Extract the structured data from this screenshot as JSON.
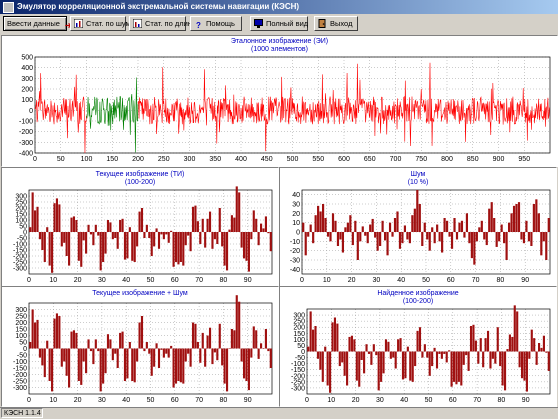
{
  "window": {
    "title": "Эмулятор корреляционной экстремальной системы навигации (КЭСН)"
  },
  "toolbar": {
    "enter_data": "Ввести данные",
    "stat_noise": "Стат. по шуму",
    "stat_length": "Стат. по длине",
    "help": "Помощь",
    "full_view": "Полный вид",
    "exit": "Выход"
  },
  "icons": [
    "arrow-right-icon",
    "chart-icon",
    "chart-icon",
    "help-icon",
    "monitor-icon",
    "exit-door-icon"
  ],
  "colors": {
    "reference": "#ff0000",
    "highlight": "#008000",
    "bars": "#a01010",
    "titles": "#0000c0"
  },
  "status": {
    "version": "КЭСН 1.1.4"
  },
  "charts": {
    "reference": {
      "title": "Эталонное изображение (ЭИ)",
      "subtitle": "(1000 элементов)"
    },
    "current": {
      "title": "Текущее изображение (ТИ)",
      "subtitle": "(100-200)"
    },
    "noise": {
      "title": "Шум",
      "subtitle": "(10 %)"
    },
    "current_noise": {
      "title": "Текущее изображение + Шум",
      "subtitle": ""
    },
    "found": {
      "title": "Найденное изображение",
      "subtitle": "(100-200)"
    }
  },
  "chart_data": [
    {
      "type": "line",
      "title": "Эталонное изображение (ЭИ)",
      "subtitle": "(1000 элементов)",
      "xlim": [
        0,
        1000
      ],
      "ylim": [
        -400,
        500
      ],
      "xticks": [
        0,
        50,
        100,
        150,
        200,
        250,
        300,
        350,
        400,
        450,
        500,
        550,
        600,
        650,
        700,
        750,
        800,
        850,
        900,
        950
      ],
      "yticks": [
        500,
        400,
        300,
        200,
        100,
        0,
        -100,
        -200,
        -300,
        -400
      ],
      "highlight_range": [
        100,
        200
      ],
      "n": 1000,
      "grid": true
    },
    {
      "type": "bar",
      "title": "Текущее изображение (ТИ)",
      "subtitle": "(100-200)",
      "xlim": [
        0,
        100
      ],
      "ylim": [
        -350,
        350
      ],
      "xticks": [
        0,
        10,
        20,
        30,
        40,
        50,
        60,
        70,
        80,
        90
      ],
      "yticks": [
        300,
        250,
        200,
        150,
        100,
        50,
        0,
        -50,
        -100,
        -150,
        -200,
        -250,
        -300
      ],
      "values": [
        40,
        330,
        180,
        210,
        -60,
        -150,
        -250,
        40,
        -280,
        -340,
        240,
        280,
        230,
        -120,
        -90,
        -200,
        -280,
        120,
        130,
        100,
        -240,
        -290,
        -70,
        -180,
        60,
        -20,
        -110,
        60,
        -30,
        -320,
        -250,
        -180,
        100,
        80,
        -60,
        -50,
        -140,
        100,
        110,
        -230,
        -220,
        40,
        -240,
        -250,
        -120,
        170,
        200,
        -50,
        60,
        -50,
        -200,
        -120,
        30,
        -140,
        -20,
        -60,
        -20,
        -90,
        10,
        -290,
        -250,
        -270,
        -250,
        -280,
        -110,
        -30,
        -160,
        210,
        220,
        90,
        -100,
        110,
        -130,
        110,
        170,
        -140,
        -60,
        -100,
        200,
        -120,
        -280,
        -320,
        20,
        140,
        120,
        380,
        330,
        -130,
        -220,
        -240,
        -330,
        -60,
        180,
        110,
        -110,
        70,
        30,
        130,
        -10,
        -160
      ]
    },
    {
      "type": "bar",
      "title": "Шум",
      "subtitle": "(10 %)",
      "xlim": [
        0,
        100
      ],
      "ylim": [
        -45,
        45
      ],
      "xticks": [
        0,
        10,
        20,
        30,
        40,
        50,
        60,
        70,
        80,
        90
      ],
      "yticks": [
        40,
        30,
        20,
        10,
        0,
        -10,
        -20,
        -30,
        -40
      ],
      "values": [
        10,
        -25,
        -5,
        8,
        -12,
        18,
        28,
        22,
        30,
        15,
        -5,
        -10,
        20,
        12,
        -15,
        -8,
        -22,
        5,
        10,
        18,
        -14,
        12,
        -30,
        -10,
        6,
        -4,
        -12,
        8,
        14,
        -6,
        -20,
        -15,
        12,
        -9,
        -25,
        10,
        -5,
        15,
        22,
        -18,
        -12,
        7,
        -8,
        -12,
        18,
        25,
        45,
        30,
        -15,
        10,
        -8,
        -20,
        5,
        -12,
        8,
        -10,
        -22,
        15,
        12,
        -5,
        -18,
        15,
        -8,
        10,
        12,
        -6,
        20,
        -12,
        -28,
        -35,
        -10,
        5,
        12,
        -8,
        -14,
        25,
        32,
        15,
        -16,
        -10,
        8,
        -12,
        -30,
        10,
        20,
        28,
        30,
        32,
        -8,
        -12,
        12,
        -10,
        -15,
        30,
        35,
        20,
        -25,
        -10,
        -30,
        15
      ]
    },
    {
      "type": "bar",
      "title": "Текущее изображение + Шум",
      "subtitle": "",
      "xlim": [
        0,
        100
      ],
      "ylim": [
        -350,
        350
      ],
      "xticks": [
        0,
        10,
        20,
        30,
        40,
        50,
        60,
        70,
        80,
        90
      ],
      "yticks": [
        300,
        250,
        200,
        150,
        100,
        50,
        0,
        -50,
        -100,
        -150,
        -200,
        -250,
        -300
      ],
      "values": [
        50,
        300,
        200,
        220,
        -70,
        -130,
        -220,
        60,
        -250,
        -330,
        230,
        270,
        250,
        -140,
        -100,
        -210,
        -300,
        130,
        140,
        120,
        -250,
        -280,
        -100,
        -190,
        70,
        -20,
        -120,
        70,
        -20,
        -330,
        -270,
        -190,
        110,
        70,
        -90,
        -40,
        -150,
        120,
        130,
        -250,
        -230,
        50,
        -250,
        -260,
        -100,
        200,
        250,
        -20,
        50,
        -40,
        -210,
        -140,
        40,
        -150,
        -10,
        -70,
        -40,
        -70,
        20,
        -300,
        -270,
        -250,
        -260,
        -270,
        -100,
        -40,
        -140,
        200,
        190,
        50,
        -110,
        120,
        -140,
        100,
        160,
        -120,
        -30,
        -90,
        190,
        -130,
        -270,
        -330,
        0,
        150,
        140,
        410,
        360,
        -100,
        -230,
        -250,
        -320,
        -70,
        170,
        140,
        -80,
        40,
        0,
        150,
        -20,
        -150
      ]
    },
    {
      "type": "bar",
      "title": "Найденное изображение",
      "subtitle": "(100-200)",
      "xlim": [
        0,
        100
      ],
      "ylim": [
        -350,
        350
      ],
      "xticks": [
        0,
        10,
        20,
        30,
        40,
        50,
        60,
        70,
        80,
        90
      ],
      "yticks": [
        300,
        250,
        200,
        150,
        100,
        50,
        0,
        -50,
        -100,
        -150,
        -200,
        -250,
        -300
      ],
      "values": [
        40,
        330,
        180,
        210,
        -60,
        -150,
        -250,
        40,
        -280,
        -340,
        240,
        280,
        230,
        -120,
        -90,
        -200,
        -280,
        120,
        130,
        100,
        -240,
        -290,
        -70,
        -180,
        60,
        -20,
        -110,
        60,
        -30,
        -320,
        -250,
        -180,
        100,
        80,
        -60,
        -50,
        -140,
        100,
        110,
        -230,
        -220,
        40,
        -240,
        -250,
        -120,
        170,
        200,
        -50,
        60,
        -50,
        -200,
        -120,
        30,
        -140,
        -20,
        -60,
        -20,
        -90,
        10,
        -290,
        -250,
        -270,
        -250,
        -280,
        -110,
        -30,
        -160,
        210,
        220,
        90,
        -100,
        110,
        -130,
        110,
        170,
        -140,
        -60,
        -100,
        200,
        -120,
        -280,
        -320,
        20,
        140,
        120,
        380,
        330,
        -130,
        -220,
        -240,
        -330,
        -60,
        180,
        110,
        -110,
        70,
        30,
        130,
        -10,
        -160
      ]
    }
  ]
}
